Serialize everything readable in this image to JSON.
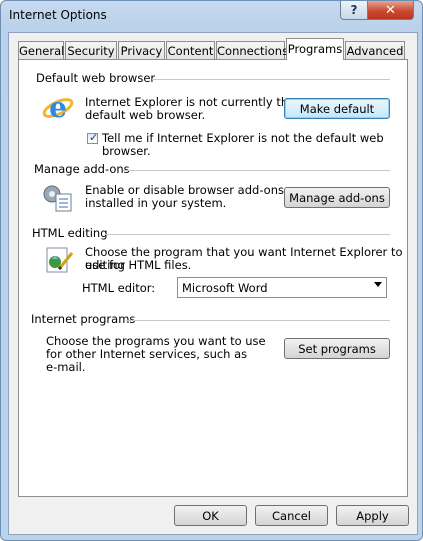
{
  "window": {
    "title": "Internet Options",
    "help_label": "?",
    "close_label": "✕"
  },
  "tabs": [
    {
      "label": "General"
    },
    {
      "label": "Security"
    },
    {
      "label": "Privacy"
    },
    {
      "label": "Content"
    },
    {
      "label": "Connections"
    },
    {
      "label": "Programs",
      "active": true
    },
    {
      "label": "Advanced"
    }
  ],
  "default_browser": {
    "title": "Default web browser",
    "text_line1": "Internet Explorer is not currently the",
    "text_line2": "default web browser.",
    "button": "Make default",
    "checkbox_checked": true,
    "checkbox_label": "Tell me if Internet Explorer is not the default web browser."
  },
  "addons": {
    "title": "Manage add-ons",
    "text_line1": "Enable or disable browser add-ons",
    "text_line2": "installed in your system.",
    "button": "Manage add-ons"
  },
  "html_editing": {
    "title": "HTML editing",
    "text_line1": "Choose the program that you want Internet Explorer to use for",
    "text_line2": "editing HTML files.",
    "editor_label": "HTML editor:",
    "editor_value": "Microsoft Word"
  },
  "internet_programs": {
    "title": "Internet programs",
    "text_line1": "Choose the programs you want to use",
    "text_line2": "for other Internet services, such as",
    "text_line3": "e-mail.",
    "button": "Set programs"
  },
  "footer": {
    "ok": "OK",
    "cancel": "Cancel",
    "apply": "Apply"
  },
  "icons": {
    "browser": "internet-explorer-icon",
    "addons": "addons-gear-icon",
    "html": "html-editor-icon"
  }
}
